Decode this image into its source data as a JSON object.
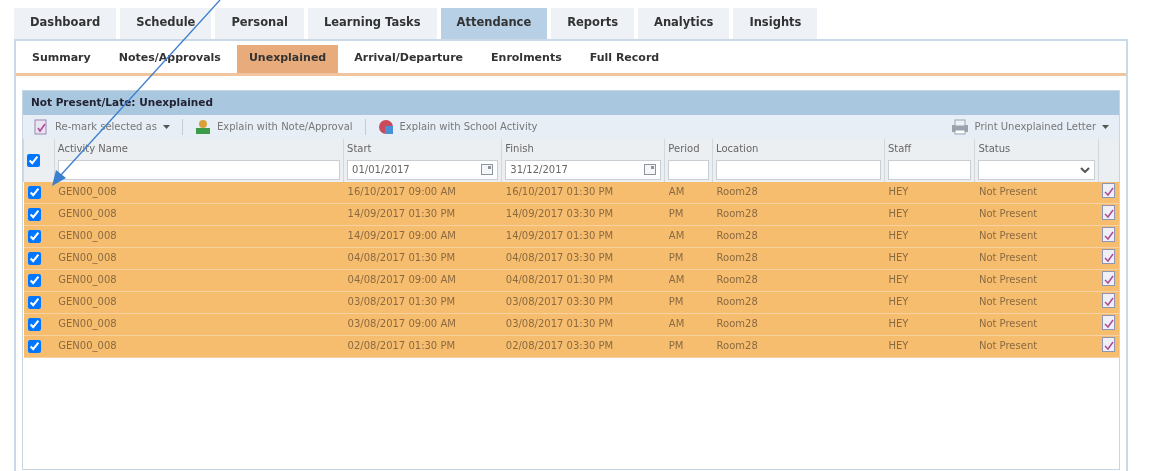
{
  "tabs": [
    {
      "label": "Dashboard",
      "selected": false
    },
    {
      "label": "Schedule",
      "selected": false
    },
    {
      "label": "Personal",
      "selected": false
    },
    {
      "label": "Learning Tasks",
      "selected": false
    },
    {
      "label": "Attendance",
      "selected": true
    },
    {
      "label": "Reports",
      "selected": false
    },
    {
      "label": "Analytics",
      "selected": false
    },
    {
      "label": "Insights",
      "selected": false
    }
  ],
  "subtabs": [
    {
      "label": "Summary",
      "selected": false
    },
    {
      "label": "Notes/Approvals",
      "selected": false
    },
    {
      "label": "Unexplained",
      "selected": true
    },
    {
      "label": "Arrival/Departure",
      "selected": false
    },
    {
      "label": "Enrolments",
      "selected": false
    },
    {
      "label": "Full Record",
      "selected": false
    }
  ],
  "panel": {
    "title": "Not Present/Late: Unexplained",
    "toolbar": [
      {
        "label": "Re-mark selected as",
        "kind": "remark",
        "dropdown": true
      },
      {
        "label": "Explain with Note/Approval",
        "kind": "note",
        "dropdown": false
      },
      {
        "label": "Explain with School Activity",
        "kind": "activity",
        "dropdown": false
      }
    ],
    "print_button": {
      "label": "Print Unexplained Letter",
      "dropdown": true
    },
    "table": {
      "select_all_checked": true,
      "columns": [
        {
          "label": "Activity Name",
          "kind": "text"
        },
        {
          "label": "Start",
          "kind": "date",
          "value": "01/01/2017"
        },
        {
          "label": "Finish",
          "kind": "date",
          "value": "31/12/2017"
        },
        {
          "label": "Period",
          "kind": "text"
        },
        {
          "label": "Location",
          "kind": "text"
        },
        {
          "label": "Staff",
          "kind": "text"
        },
        {
          "label": "Status",
          "kind": "select"
        }
      ],
      "rows": [
        {
          "checked": true,
          "cells": [
            "GEN00_008",
            "16/10/2017 09:00 AM",
            "16/10/2017 01:30 PM",
            "AM",
            "Room28",
            "HEY",
            "Not Present"
          ]
        },
        {
          "checked": true,
          "cells": [
            "GEN00_008",
            "14/09/2017 01:30 PM",
            "14/09/2017 03:30 PM",
            "PM",
            "Room28",
            "HEY",
            "Not Present"
          ]
        },
        {
          "checked": true,
          "cells": [
            "GEN00_008",
            "14/09/2017 09:00 AM",
            "14/09/2017 01:30 PM",
            "AM",
            "Room28",
            "HEY",
            "Not Present"
          ]
        },
        {
          "checked": true,
          "cells": [
            "GEN00_008",
            "04/08/2017 01:30 PM",
            "04/08/2017 03:30 PM",
            "PM",
            "Room28",
            "HEY",
            "Not Present"
          ]
        },
        {
          "checked": true,
          "cells": [
            "GEN00_008",
            "04/08/2017 09:00 AM",
            "04/08/2017 01:30 PM",
            "AM",
            "Room28",
            "HEY",
            "Not Present"
          ]
        },
        {
          "checked": true,
          "cells": [
            "GEN00_008",
            "03/08/2017 01:30 PM",
            "03/08/2017 03:30 PM",
            "PM",
            "Room28",
            "HEY",
            "Not Present"
          ]
        },
        {
          "checked": true,
          "cells": [
            "GEN00_008",
            "03/08/2017 09:00 AM",
            "03/08/2017 01:30 PM",
            "AM",
            "Room28",
            "HEY",
            "Not Present"
          ]
        },
        {
          "checked": true,
          "cells": [
            "GEN00_008",
            "02/08/2017 01:30 PM",
            "02/08/2017 03:30 PM",
            "PM",
            "Room28",
            "HEY",
            "Not Present"
          ]
        }
      ]
    }
  }
}
